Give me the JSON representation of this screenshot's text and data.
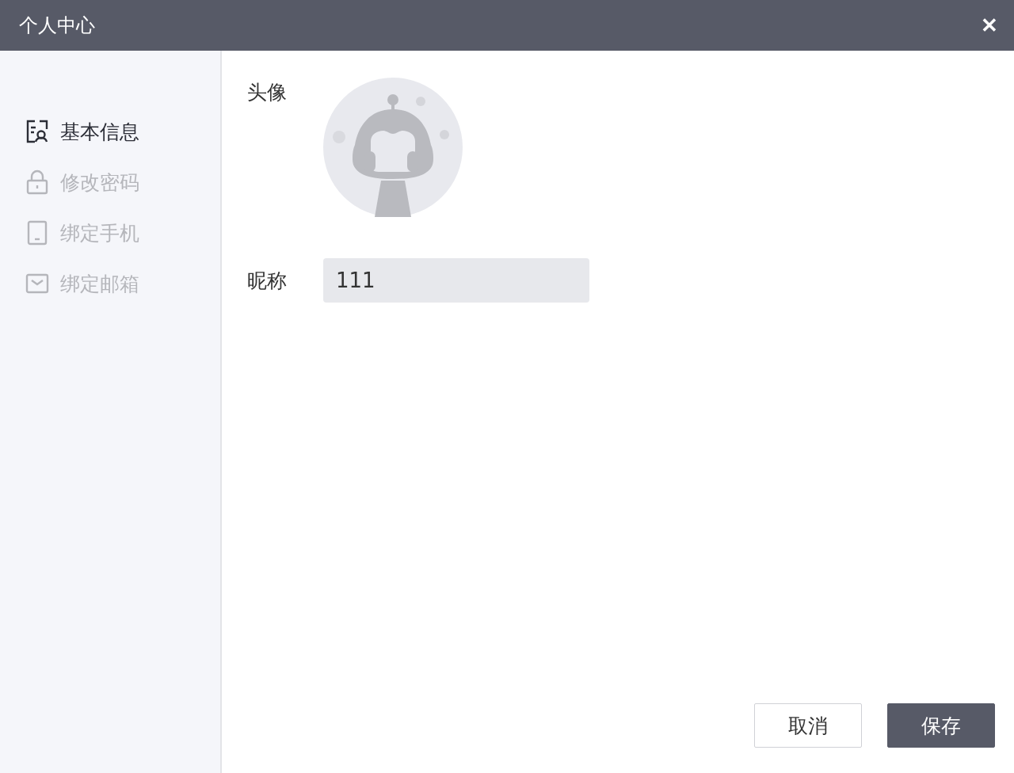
{
  "window": {
    "title": "个人中心",
    "close": "✕"
  },
  "sidebar": {
    "items": [
      {
        "kind": "profile",
        "label": "基本信息",
        "selected": true
      },
      {
        "kind": "lock",
        "label": "修改密码",
        "selected": false
      },
      {
        "kind": "phone",
        "label": "绑定手机",
        "selected": false
      },
      {
        "kind": "mail",
        "label": "绑定邮箱",
        "selected": false
      }
    ]
  },
  "form": {
    "avatar_label": "头像",
    "nickname_label": "昵称",
    "nickname_value": "111"
  },
  "buttons": [
    {
      "kind": "secondary",
      "label": "取消"
    },
    {
      "kind": "primary",
      "label": "保存"
    }
  ]
}
